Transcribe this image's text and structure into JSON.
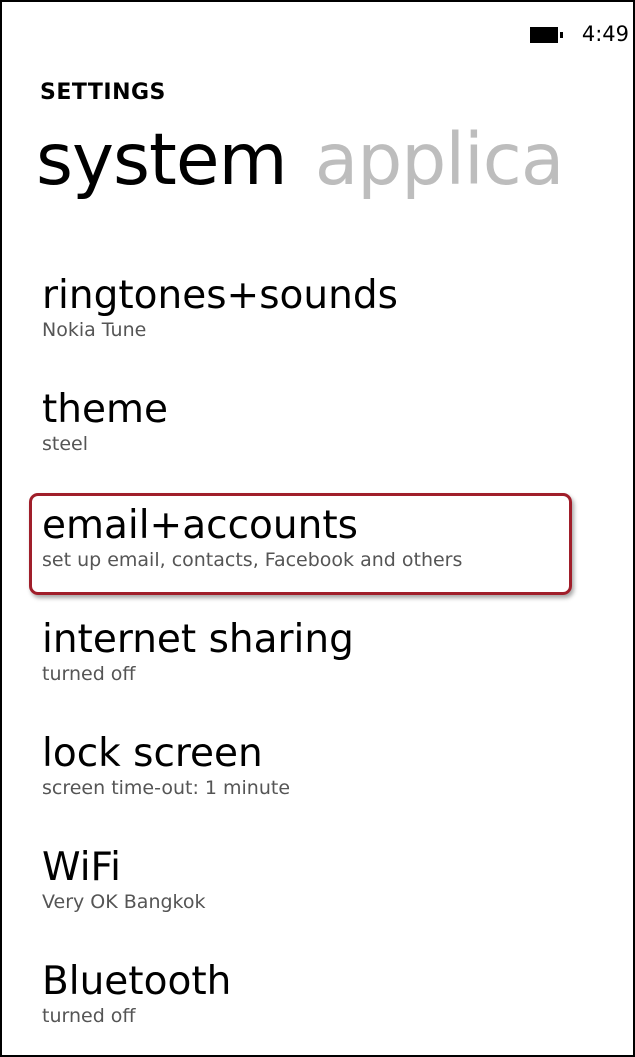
{
  "status_bar": {
    "time": "4:49",
    "battery_icon": "battery-icon"
  },
  "header": {
    "app_title": "SETTINGS"
  },
  "pivot": {
    "active": "system",
    "next": "applica"
  },
  "settings_items": [
    {
      "title": "ringtones+sounds",
      "subtitle": "Nokia Tune"
    },
    {
      "title": "theme",
      "subtitle": "steel"
    },
    {
      "title": "email+accounts",
      "subtitle": "set up email, contacts, Facebook and others"
    },
    {
      "title": "internet sharing",
      "subtitle": "turned off"
    },
    {
      "title": "lock screen",
      "subtitle": "screen time-out: 1 minute"
    },
    {
      "title": "WiFi",
      "subtitle": "Very OK Bangkok"
    },
    {
      "title": "Bluetooth",
      "subtitle": "turned off"
    }
  ],
  "colors": {
    "highlight_border": "#a01e2a",
    "inactive_pivot": "#bdbdbd",
    "subtitle": "#555555"
  }
}
